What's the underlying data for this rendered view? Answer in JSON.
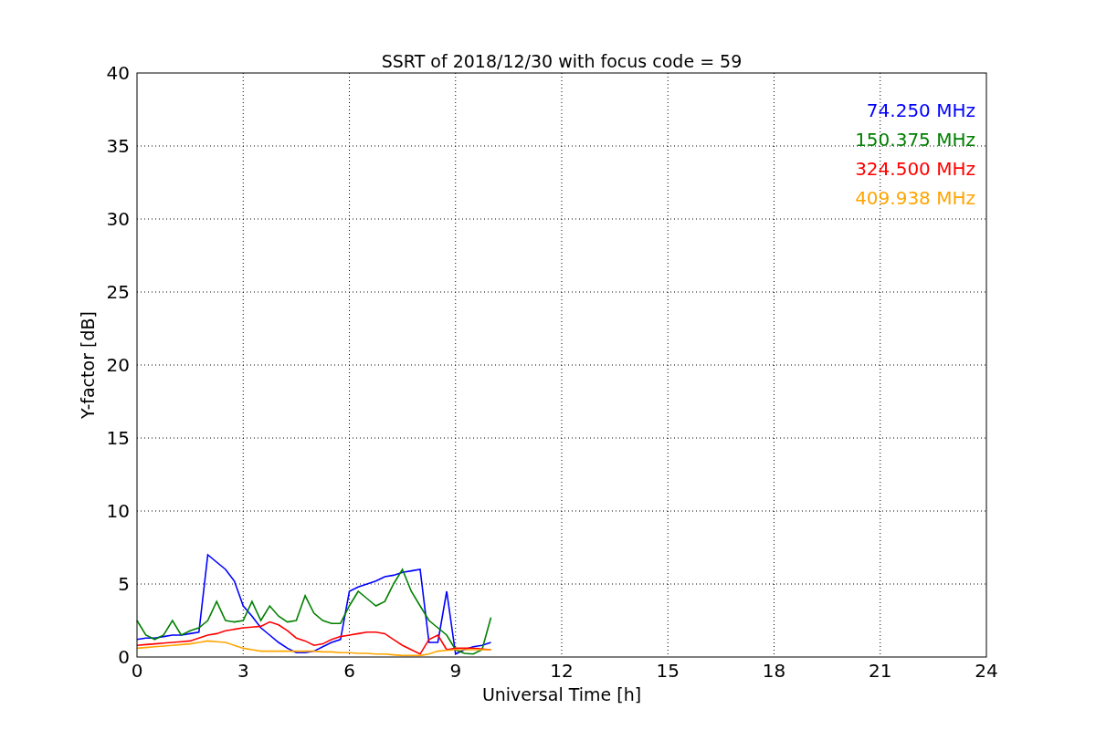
{
  "chart_data": {
    "type": "line",
    "title": "SSRT of 2018/12/30 with focus code = 59",
    "xlabel": "Universal Time [h]",
    "ylabel": "Y-factor [dB]",
    "x": [
      0,
      0.25,
      0.5,
      0.75,
      1,
      1.25,
      1.5,
      1.75,
      2,
      2.25,
      2.5,
      2.75,
      3,
      3.25,
      3.5,
      3.75,
      4,
      4.25,
      4.5,
      4.75,
      5,
      5.25,
      5.5,
      5.75,
      6,
      6.25,
      6.5,
      6.75,
      7,
      7.25,
      7.5,
      7.75,
      8,
      8.25,
      8.5,
      8.75,
      9,
      9.25,
      9.5,
      9.75,
      10
    ],
    "series": [
      {
        "name": "74.250 MHz",
        "color": "#0000ff",
        "values": [
          1.2,
          1.3,
          1.3,
          1.4,
          1.5,
          1.5,
          1.6,
          1.7,
          7,
          6.5,
          6,
          5.2,
          3.5,
          2.8,
          2,
          1.5,
          1,
          0.6,
          0.3,
          0.3,
          0.4,
          0.7,
          1,
          1.2,
          4.5,
          4.8,
          5,
          5.2,
          5.5,
          5.6,
          5.8,
          5.9,
          6,
          1,
          1,
          4.5,
          0.2,
          0.5,
          0.7,
          0.8,
          1
        ]
      },
      {
        "name": "150.375 MHz",
        "color": "#008000",
        "values": [
          2.5,
          1.5,
          1.2,
          1.5,
          2.5,
          1.5,
          1.8,
          2,
          2.5,
          3.8,
          2.5,
          2.4,
          2.5,
          3.8,
          2.5,
          3.5,
          2.8,
          2.4,
          2.5,
          4.2,
          3,
          2.5,
          2.3,
          2.3,
          3.5,
          4.5,
          4,
          3.5,
          3.8,
          5,
          6,
          4.5,
          3.5,
          2.5,
          2,
          1.5,
          0.5,
          0.25,
          0.2,
          0.5,
          2.7
        ]
      },
      {
        "name": "324.500 MHz",
        "color": "#ff0000",
        "values": [
          0.8,
          0.85,
          0.9,
          0.95,
          1,
          1.05,
          1.1,
          1.3,
          1.5,
          1.6,
          1.8,
          1.9,
          2,
          2.05,
          2.1,
          2.4,
          2.2,
          1.8,
          1.3,
          1.1,
          0.8,
          0.9,
          1.2,
          1.4,
          1.5,
          1.6,
          1.7,
          1.7,
          1.6,
          1.2,
          0.8,
          0.5,
          0.2,
          1.2,
          1.5,
          0.5,
          0.6,
          0.6,
          0.6,
          0.55,
          0.5
        ]
      },
      {
        "name": "409.938 MHz",
        "color": "#ffa500",
        "values": [
          0.6,
          0.65,
          0.7,
          0.75,
          0.8,
          0.85,
          0.9,
          1,
          1.1,
          1.05,
          1,
          0.8,
          0.6,
          0.5,
          0.4,
          0.4,
          0.4,
          0.4,
          0.4,
          0.4,
          0.4,
          0.35,
          0.35,
          0.3,
          0.3,
          0.25,
          0.25,
          0.2,
          0.2,
          0.15,
          0.1,
          0.1,
          0.1,
          0.2,
          0.4,
          0.45,
          0.5,
          0.5,
          0.5,
          0.5,
          0.5
        ]
      }
    ],
    "grid": true,
    "xlim": [
      0,
      24
    ],
    "ylim": [
      0,
      40
    ],
    "xticks": [
      0,
      3,
      6,
      9,
      12,
      15,
      18,
      21,
      24
    ],
    "yticks": [
      0,
      5,
      10,
      15,
      20,
      25,
      30,
      35,
      40
    ]
  }
}
